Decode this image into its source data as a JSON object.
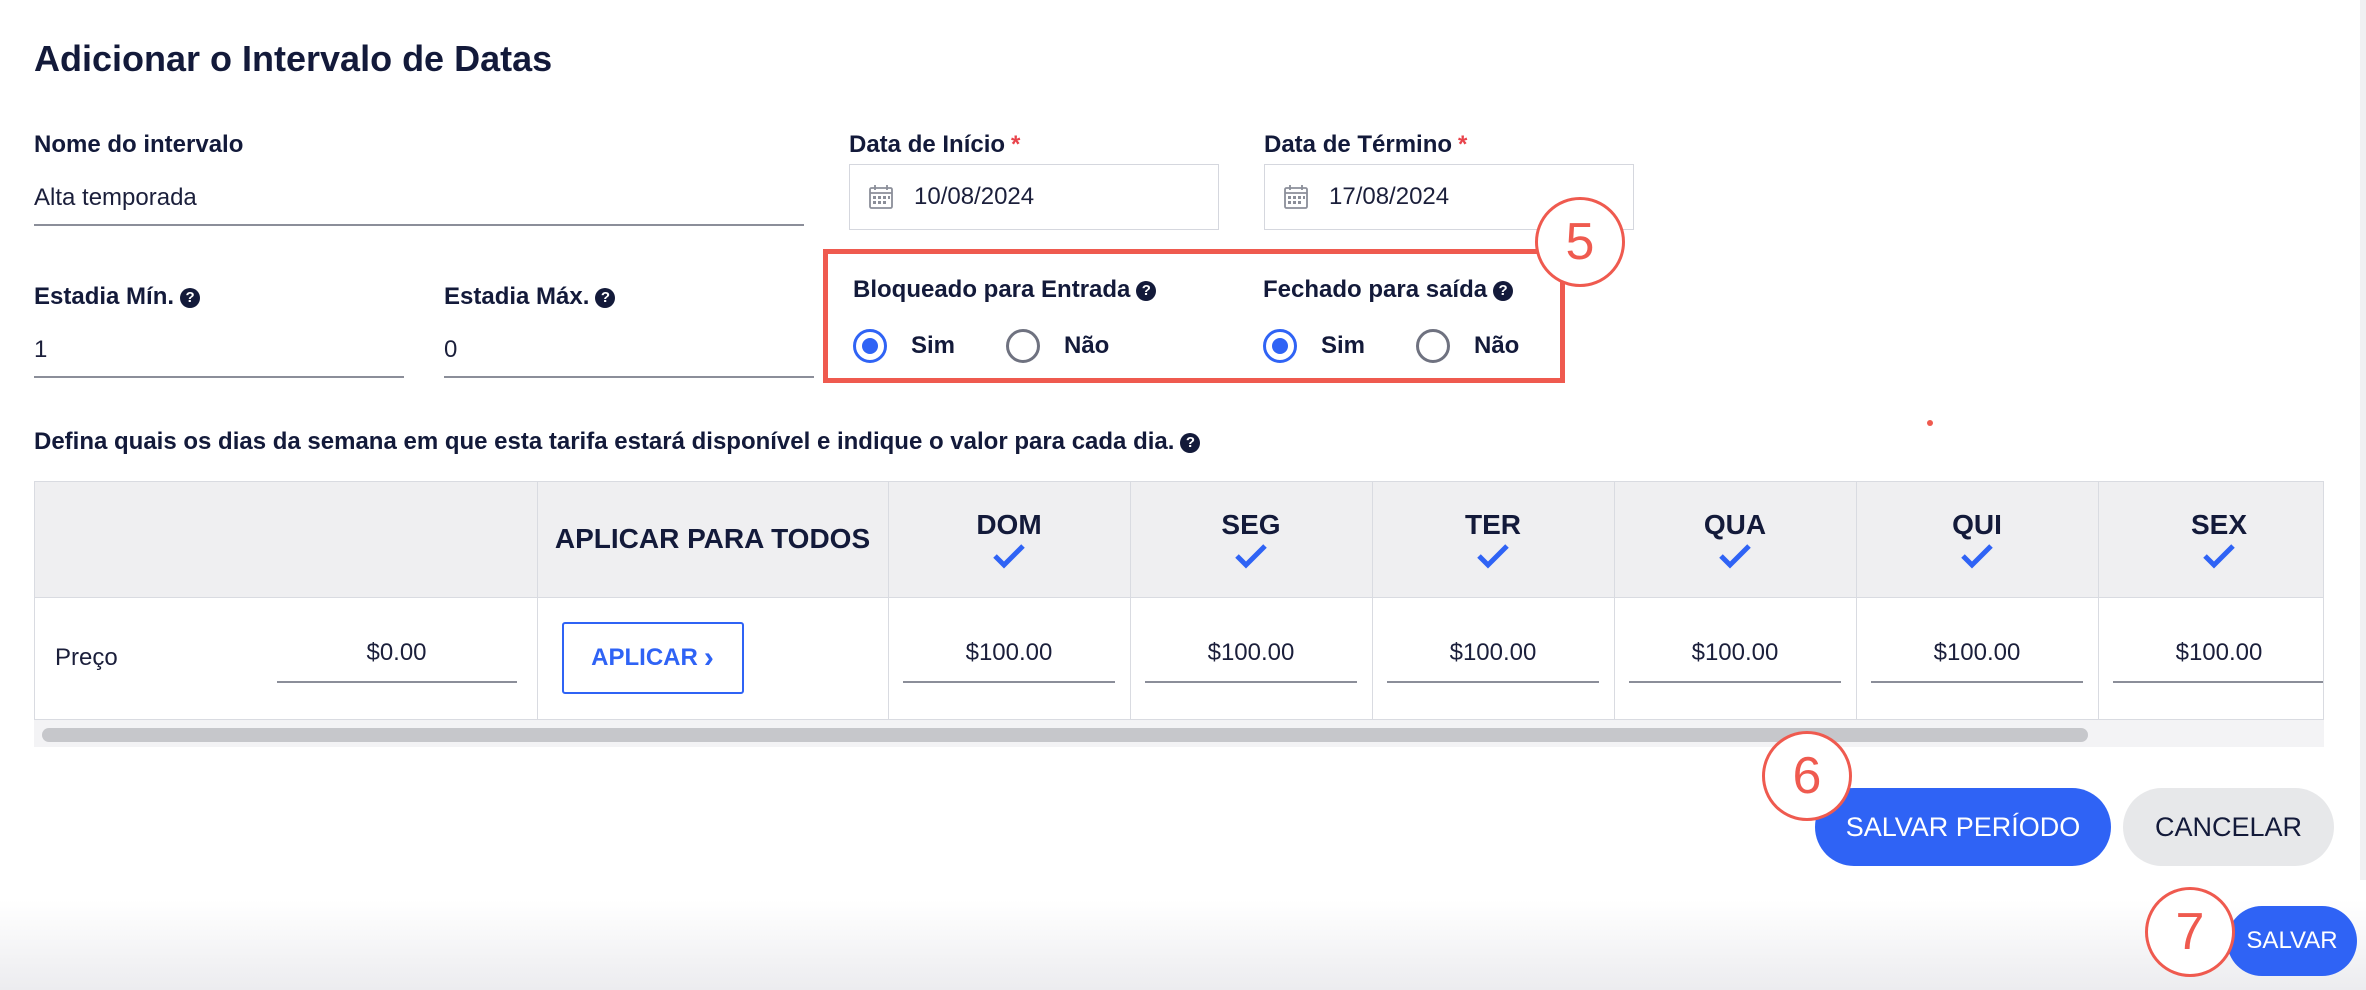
{
  "title": "Adicionar o Intervalo de Datas",
  "fields": {
    "name_label": "Nome do intervalo",
    "name_value": "Alta temporada",
    "start_label": "Data de Início",
    "start_value": "10/08/2024",
    "end_label": "Data de Término",
    "end_value": "17/08/2024",
    "required_mark": "*",
    "min_stay_label": "Estadia Mín.",
    "min_stay_value": "1",
    "max_stay_label": "Estadia Máx.",
    "max_stay_value": "0"
  },
  "restrictions": {
    "closed_arrival_label": "Bloqueado para Entrada",
    "closed_departure_label": "Fechado para saída",
    "yes": "Sim",
    "no": "Não",
    "closed_arrival_selected": "Sim",
    "closed_departure_selected": "Sim"
  },
  "help_glyph": "?",
  "instruction": "Defina quais os dias da semana em que esta tarifa estará disponível e indique o valor para cada dia.",
  "grid": {
    "apply_all_header": "APLICAR PARA TODOS",
    "days": [
      "DOM",
      "SEG",
      "TER",
      "QUA",
      "QUI",
      "SEX"
    ],
    "price_label": "Preço",
    "base_price": "$0.00",
    "apply_button": "APLICAR",
    "apply_chevron": "›",
    "day_prices": [
      "$100.00",
      "$100.00",
      "$100.00",
      "$100.00",
      "$100.00",
      "$100.00"
    ]
  },
  "buttons": {
    "save_period": "SALVAR PERÍODO",
    "cancel": "CANCELAR",
    "save": "SALVAR"
  },
  "callouts": [
    "5",
    "6",
    "7"
  ],
  "colors": {
    "accent": "#2f63f5",
    "annotation": "#ef5a4f",
    "required": "#e8434b",
    "text": "#131a3a"
  }
}
